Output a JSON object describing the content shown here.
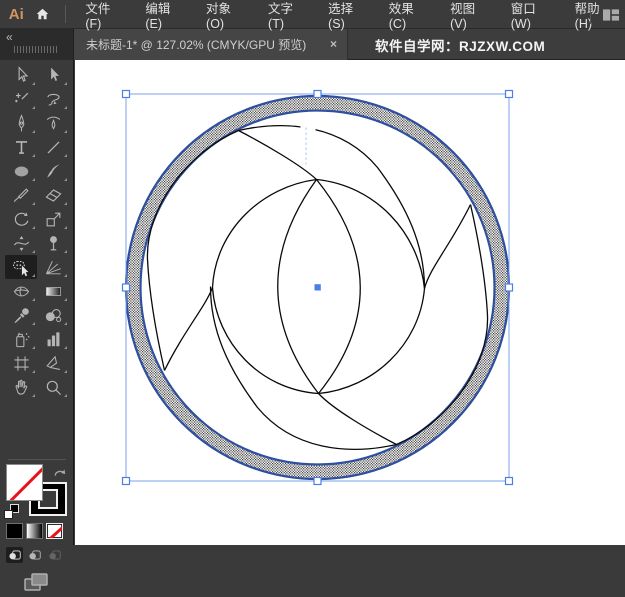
{
  "menubar": {
    "logo": "Ai",
    "items": [
      "文件(F)",
      "编辑(E)",
      "对象(O)",
      "文字(T)",
      "选择(S)",
      "效果(C)",
      "视图(V)",
      "窗口(W)",
      "帮助(H)"
    ]
  },
  "tabbar": {
    "collapse_glyph": "«",
    "tab_title": "未标题-1* @ 127.02% (CMYK/GPU 预览)",
    "close_glyph": "×",
    "site_label": "软件自学网：RJZXW.COM"
  },
  "document": {
    "name": "未标题-1*",
    "zoom": "127.02%",
    "color_mode": "CMYK",
    "preview_mode": "GPU 预览",
    "selection": "circle artwork selected with bounding box",
    "active_tool": "shape-builder-tool"
  },
  "toolbar": {
    "tools": [
      {
        "name": "selection-tool",
        "icon": "sel"
      },
      {
        "name": "direct-selection-tool",
        "icon": "dsel"
      },
      {
        "name": "magic-wand-tool",
        "icon": "wand"
      },
      {
        "name": "lasso-tool",
        "icon": "lasso"
      },
      {
        "name": "pen-tool",
        "icon": "pen"
      },
      {
        "name": "curvature-tool",
        "icon": "cpen"
      },
      {
        "name": "type-tool",
        "icon": "type"
      },
      {
        "name": "line-segment-tool",
        "icon": "line"
      },
      {
        "name": "ellipse-tool",
        "icon": "ellipse"
      },
      {
        "name": "paintbrush-tool",
        "icon": "brush"
      },
      {
        "name": "shaper-tool",
        "icon": "shaper"
      },
      {
        "name": "eraser-tool",
        "icon": "eraser"
      },
      {
        "name": "rotate-tool",
        "icon": "rotate"
      },
      {
        "name": "scale-tool",
        "icon": "scale"
      },
      {
        "name": "width-tool",
        "icon": "width"
      },
      {
        "name": "puppet-warp-tool",
        "icon": "pin"
      },
      {
        "name": "shape-builder-tool",
        "icon": "builder",
        "selected": true
      },
      {
        "name": "perspective-grid-tool",
        "icon": "persp"
      },
      {
        "name": "mesh-tool",
        "icon": "mesh"
      },
      {
        "name": "gradient-tool",
        "icon": "grad"
      },
      {
        "name": "eyedropper-tool",
        "icon": "eyedrop"
      },
      {
        "name": "blend-tool",
        "icon": "blend"
      },
      {
        "name": "symbol-sprayer-tool",
        "icon": "spray"
      },
      {
        "name": "column-graph-tool",
        "icon": "graph"
      },
      {
        "name": "artboard-tool",
        "icon": "artboard"
      },
      {
        "name": "slice-tool",
        "icon": "slice"
      },
      {
        "name": "hand-tool",
        "icon": "hand"
      },
      {
        "name": "zoom-tool",
        "icon": "zoomtool"
      }
    ],
    "fill_swatch": "none (white with red slash)",
    "stroke_swatch": "black",
    "appearance_buttons": [
      {
        "name": "color",
        "active": false
      },
      {
        "name": "gradient",
        "active": false
      },
      {
        "name": "none",
        "active": true
      }
    ],
    "drawing_modes": [
      {
        "name": "draw-normal",
        "active": true
      },
      {
        "name": "draw-behind",
        "active": false
      },
      {
        "name": "draw-inside",
        "disabled": true
      }
    ]
  },
  "colors": {
    "selection_blue": "#4a7fe8",
    "bbox_blue": "#7ba3ef",
    "ring_stroke": "#2f4f9f",
    "artwork_stroke": "#0a0a0a",
    "none_red": "#e8141c",
    "ui_dark": "#3a3a3a",
    "logo_orange": "#d2955d"
  }
}
